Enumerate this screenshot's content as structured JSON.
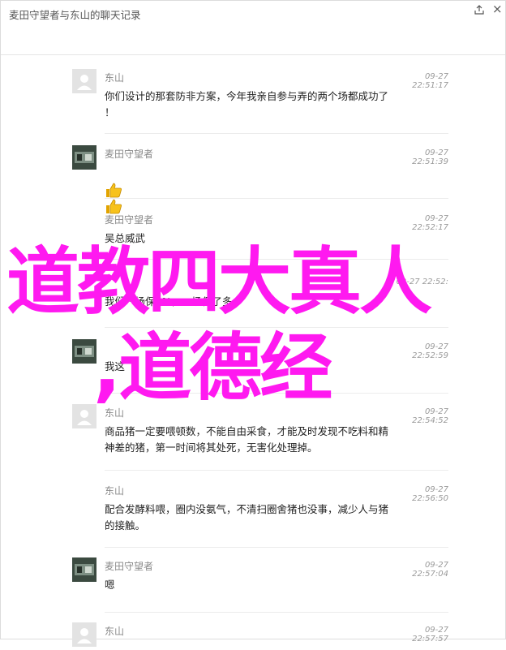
{
  "window": {
    "title": "麦田守望者与东山的聊天记录",
    "share_icon": "share-icon",
    "close_label": "×"
  },
  "messages": [
    {
      "name": "东山",
      "time": "09-27 22:51:17",
      "text": "你们设计的那套防非方案，今年我亲自参与弄的两个场都成功了\n！",
      "avatar": "default"
    },
    {
      "name": "麦田守望者",
      "time": "09-27 22:51:39",
      "text": "",
      "avatar": "photo",
      "emoji": [
        "thumbs-up-icon",
        "thumbs-up-icon"
      ]
    },
    {
      "name": "麦田守望者",
      "time": "09-27 22:52:17",
      "text": "吴总威武",
      "avatar": "none"
    },
    {
      "name": "",
      "time": "09-27 22:52:",
      "text": "我们一场保5%，一场保了多个",
      "avatar": "none"
    },
    {
      "name": "",
      "time": "09-27 22:52:59",
      "text": "我这",
      "avatar": "photo"
    },
    {
      "name": "东山",
      "time": "09-27 22:54:52",
      "text": "商品猪一定要喂顿数，不能自由采食，才能及时发现不吃料和精\n神差的猪，第一时间将其处死，无害化处理掉。",
      "avatar": "default"
    },
    {
      "name": "东山",
      "time": "09-27 22:56:50",
      "text": "配合发酵料喂，圈内没氨气，不清扫圈舍猪也没事，减少人与猪\n的接触。",
      "avatar": "none"
    },
    {
      "name": "麦田守望者",
      "time": "09-27 22:57:04",
      "text": "嗯",
      "avatar": "photo"
    },
    {
      "name": "东山",
      "time": "09-27 22:57:57",
      "text": "",
      "avatar": "default"
    }
  ],
  "overlay": {
    "line1": "道教四大真人",
    "line2": ",道德经",
    "color": "#ff19f0"
  }
}
